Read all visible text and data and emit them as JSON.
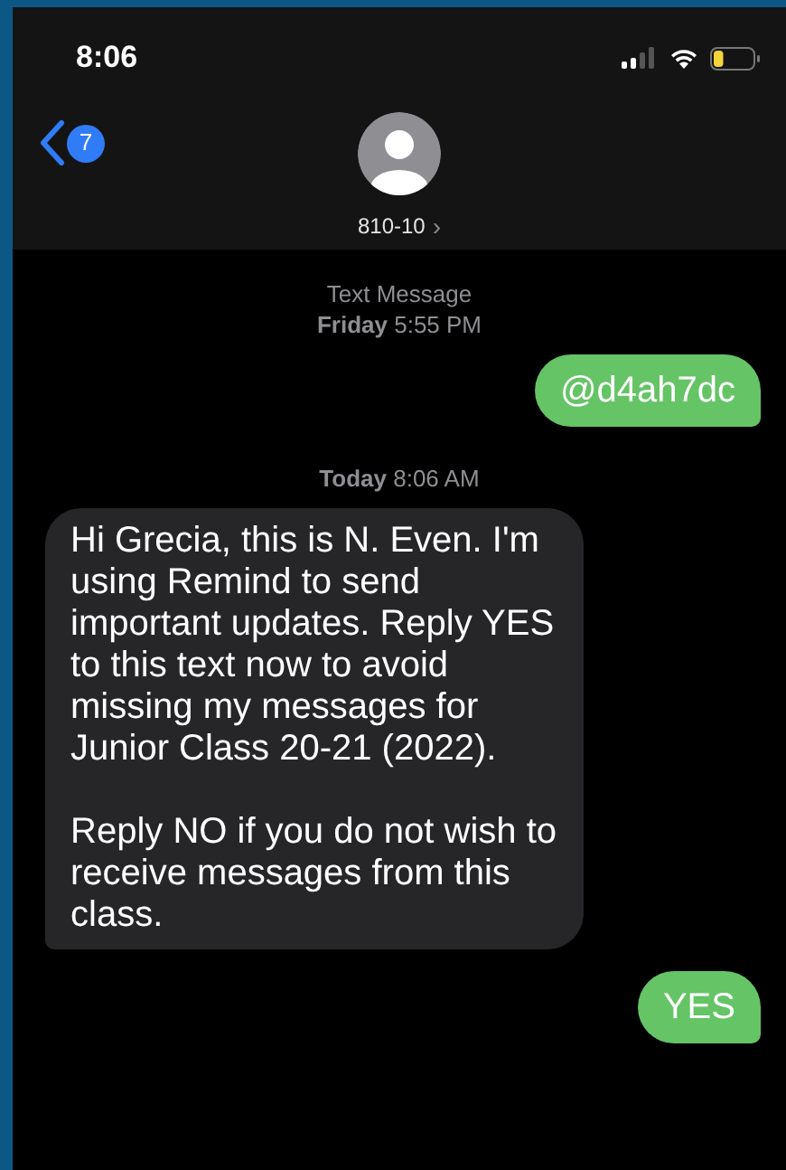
{
  "status_bar": {
    "time": "8:06"
  },
  "header": {
    "back_badge": "7",
    "contact": "810-10",
    "contact_chevron": "›"
  },
  "thread": [
    {
      "kind": "timestamp",
      "lines": [
        "Text Message",
        "**Friday** 5:55 PM"
      ]
    },
    {
      "kind": "sent",
      "paragraphs": [
        "@d4ah7dc"
      ]
    },
    {
      "kind": "timestamp",
      "lines": [
        "**Today** 8:06 AM"
      ]
    },
    {
      "kind": "received",
      "paragraphs": [
        "Hi Grecia, this is N. Even. I'm using Remind to send important updates. Reply YES to this text now to avoid missing my messages for Junior Class 20-21 (2022).",
        "Reply NO if you do not wish to receive messages from this class."
      ]
    },
    {
      "kind": "sent",
      "paragraphs": [
        "YES"
      ]
    }
  ]
}
